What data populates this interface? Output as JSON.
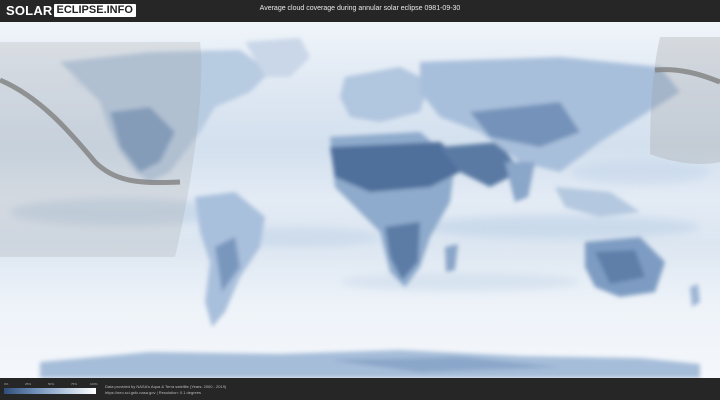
{
  "header": {
    "logo_part1": "SOLAR",
    "logo_part2": "ECLIPSE.INFO",
    "title": "Average cloud coverage during annular solar eclipse 0981-09-30"
  },
  "legend": {
    "ticks": [
      "0%",
      "25%",
      "50%",
      "75%",
      "100%"
    ],
    "colors": [
      "#2f4f7a",
      "#6f8fb8",
      "#b5c9e0",
      "#ffffff"
    ]
  },
  "credits": {
    "line1": "Data provided by NASA's Aqua & Terra satellite (Years: 2000 - 2019)",
    "line2": "https://neo.sci.gsfc.nasa.gov | Resolution: 0.1 degrees"
  },
  "colors": {
    "cloud_light": "#eef3f9",
    "cloud_mid": "#a9c0dc",
    "cloud_dark": "#5d7ea8",
    "eclipse_path": "#7f7f7f",
    "visibility_zone": "#9a9a9a"
  }
}
